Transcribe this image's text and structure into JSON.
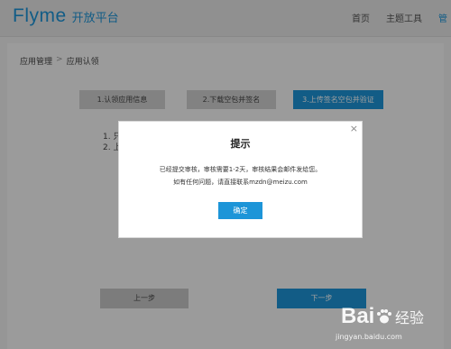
{
  "header": {
    "brand": "Flyme",
    "brand_sub": "开放平台",
    "nav": [
      "首页",
      "主题工具",
      "管"
    ]
  },
  "breadcrumb": [
    "应用管理",
    "应用认领"
  ],
  "breadcrumb_sep": ">",
  "steps": [
    {
      "label": "1.认领应用信息",
      "active": false
    },
    {
      "label": "2.下载空包并签名",
      "active": false
    },
    {
      "label": "3.上传签名空包并验证",
      "active": true
    }
  ],
  "notes": [
    "1. 只",
    "2. 上"
  ],
  "buttons": {
    "prev": "上一步",
    "next": "下一步"
  },
  "modal": {
    "close": "×",
    "title": "提示",
    "line1": "已经提交审核，审核需要1-2天，审核结果会邮件发给您。",
    "line2": "如有任何问题，请直接联系mzdn@meizu.com",
    "confirm": "确定"
  },
  "watermark": {
    "brand": "Bai",
    "jingyan": "经验",
    "url": "jingyan.baidu.com"
  },
  "colors": {
    "accent": "#1d95d8"
  }
}
